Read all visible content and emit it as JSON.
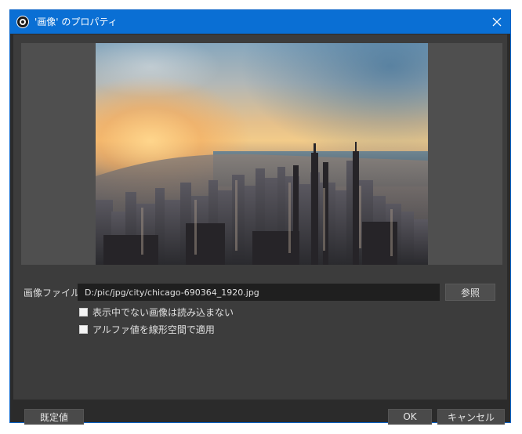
{
  "window": {
    "title": "'画像' のプロパティ",
    "icons": {
      "app": "obs-logo-icon",
      "close": "close-icon"
    }
  },
  "preview": {
    "image_alt": "city skyline at sunset"
  },
  "form": {
    "file_label": "画像ファイル",
    "file_value": "D:/pic/jpg/city/chicago-690364_1920.jpg",
    "browse_label": "参照"
  },
  "options": [
    {
      "label": "表示中でない画像は読み込まない",
      "checked": false
    },
    {
      "label": "アルファ値を線形空間で適用",
      "checked": false
    }
  ],
  "footer": {
    "defaults_label": "既定値",
    "ok_label": "OK",
    "cancel_label": "キャンセル"
  },
  "colors": {
    "titlebar": "#0a6fd4",
    "background": "#3c3c3c",
    "input_bg": "#1f1f1f",
    "button_bg": "#4a4a4a"
  }
}
